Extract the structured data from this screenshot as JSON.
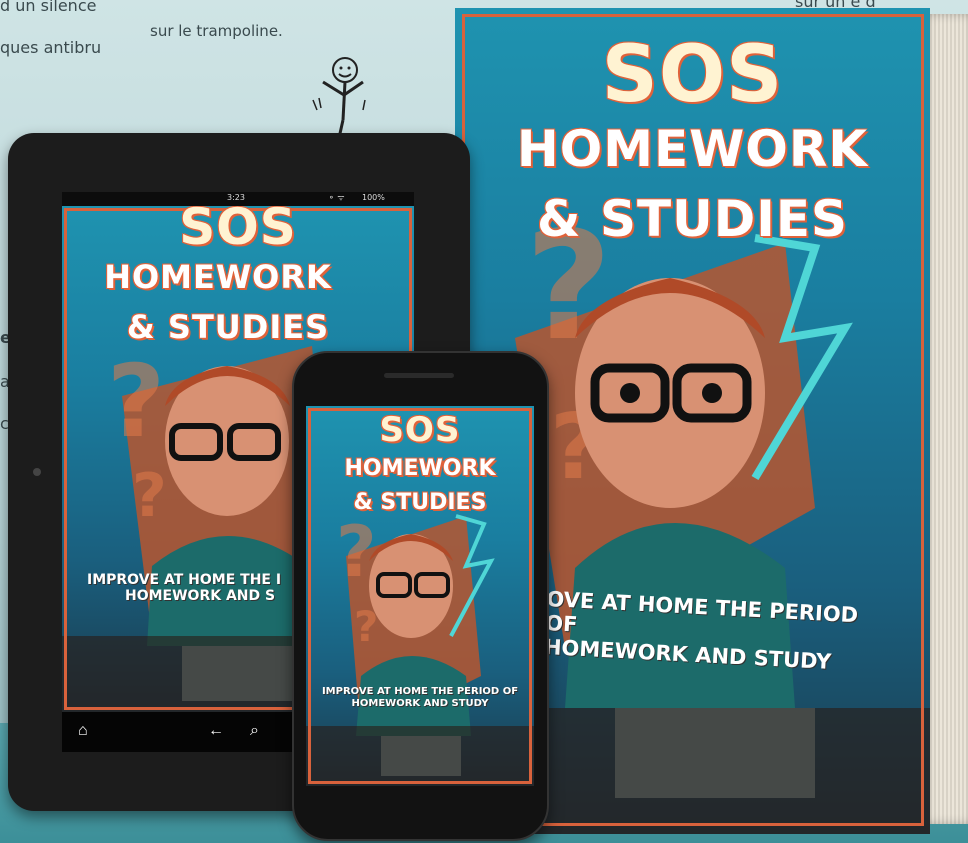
{
  "background_text": {
    "line1": "d un silence",
    "line2": "ques antibru",
    "line3": "sur le trampoline.",
    "line4": "sur un      e d",
    "fragment_e": "e",
    "fragment_l": "al",
    "fragment_c": "c"
  },
  "cover": {
    "title_top": "SOS",
    "title_mid": "HOMEWORK",
    "title_bottom": "& STUDIES",
    "subtitle_line1": "IMPROVE AT HOME THE PERIOD OF",
    "subtitle_line2": "HOMEWORK   AND STUDY"
  },
  "book_cover": {
    "subtitle_line1": "OVE AT HOME THE PERIOD OF",
    "subtitle_line2": "HOMEWORK   AND STUDY"
  },
  "tablet": {
    "status_time": "3:23",
    "status_battery": "100%",
    "subtitle_line1": "IMPROVE AT HOME THE I",
    "subtitle_line2": "HOMEWORK   AND S",
    "nav_home_icon": "home-icon",
    "nav_back_icon": "back-arrow-icon",
    "nav_search_icon": "search-icon"
  },
  "colors": {
    "cover_blue": "#1f93b0",
    "title_outline": "#e0623a",
    "frame": "#d8623c"
  }
}
